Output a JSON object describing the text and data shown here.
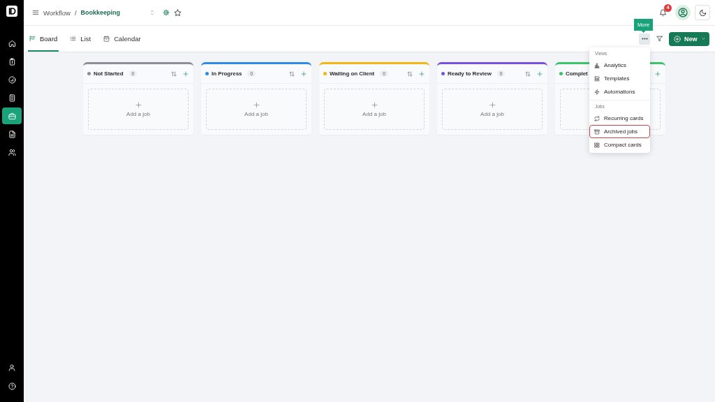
{
  "sidebar": {
    "nav_items": [
      {
        "selected": false
      },
      {
        "selected": false
      },
      {
        "selected": false
      },
      {
        "selected": false
      },
      {
        "selected": true
      },
      {
        "selected": false
      },
      {
        "selected": false
      }
    ]
  },
  "header": {
    "breadcrumb_parent": "Workflow",
    "breadcrumb_separator": "/",
    "breadcrumb_current": "Bookkeeping",
    "starred": false,
    "notification_count": "4"
  },
  "tabs": [
    {
      "label": "Board",
      "selected": true
    },
    {
      "label": "List",
      "selected": false
    },
    {
      "label": "Calendar",
      "selected": false
    }
  ],
  "toolbar": {
    "tooltip": "More",
    "new_button": "New"
  },
  "columns": [
    {
      "title": "Not Started",
      "color": "#8b8e94",
      "count": "0",
      "add_label": "Add a job"
    },
    {
      "title": "In Progress",
      "color": "#2f8ae5",
      "count": "0",
      "add_label": "Add a job"
    },
    {
      "title": "Waiting on Client",
      "color": "#f2b711",
      "count": "0",
      "add_label": "Add a job"
    },
    {
      "title": "Ready to Review",
      "color": "#7752e0",
      "count": "0",
      "add_label": "Add a job"
    },
    {
      "title": "Complet",
      "color": "#3cc46c"
    }
  ],
  "menu": {
    "sections": [
      {
        "heading": "Views",
        "items": [
          {
            "label": "Analytics",
            "highlighted": false
          },
          {
            "label": "Templates",
            "highlighted": false
          },
          {
            "label": "Automations",
            "highlighted": false
          }
        ]
      },
      {
        "heading": "Jobs",
        "items": [
          {
            "label": "Recurring cards",
            "highlighted": false
          },
          {
            "label": "Archived jobs",
            "highlighted": true
          },
          {
            "label": "Compact cards",
            "highlighted": false
          }
        ]
      }
    ]
  }
}
